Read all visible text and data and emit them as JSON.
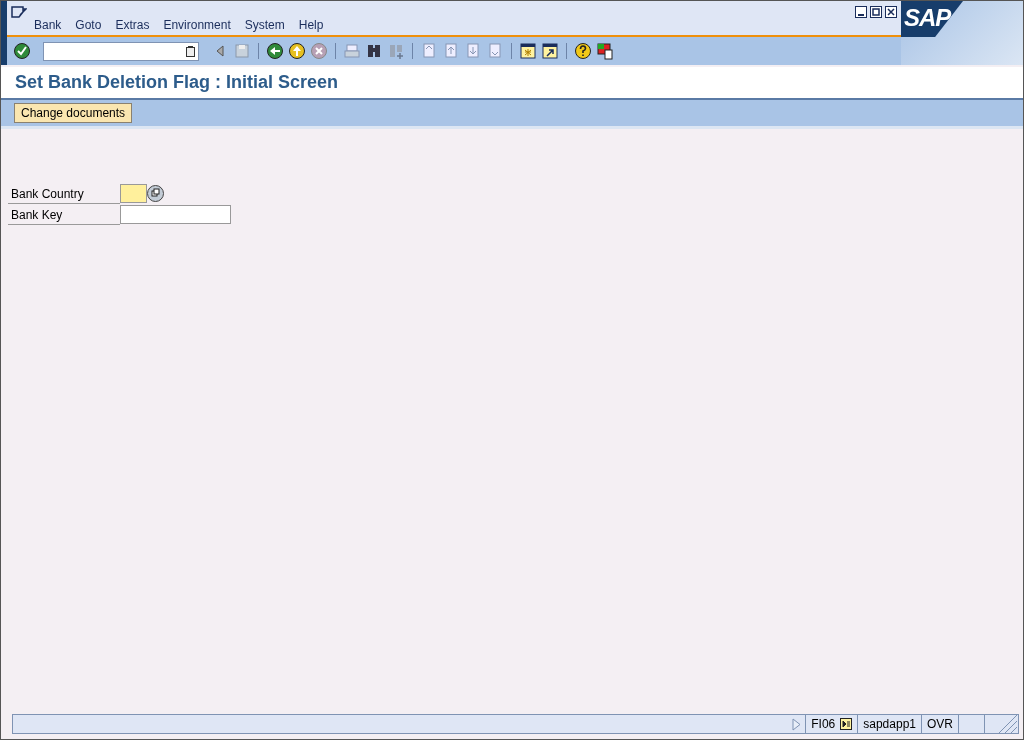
{
  "menu": [
    "Bank",
    "Goto",
    "Extras",
    "Environment",
    "System",
    "Help"
  ],
  "logo": "SAP",
  "title": "Set Bank Deletion Flag : Initial Screen",
  "app_toolbar": [
    "Change documents"
  ],
  "fields": [
    {
      "label": "Bank Country",
      "kind": "required"
    },
    {
      "label": "Bank Key",
      "kind": "plain"
    }
  ],
  "status_bar": {
    "transaction": "FI06",
    "server": "sapdapp1",
    "mode": "OVR"
  }
}
